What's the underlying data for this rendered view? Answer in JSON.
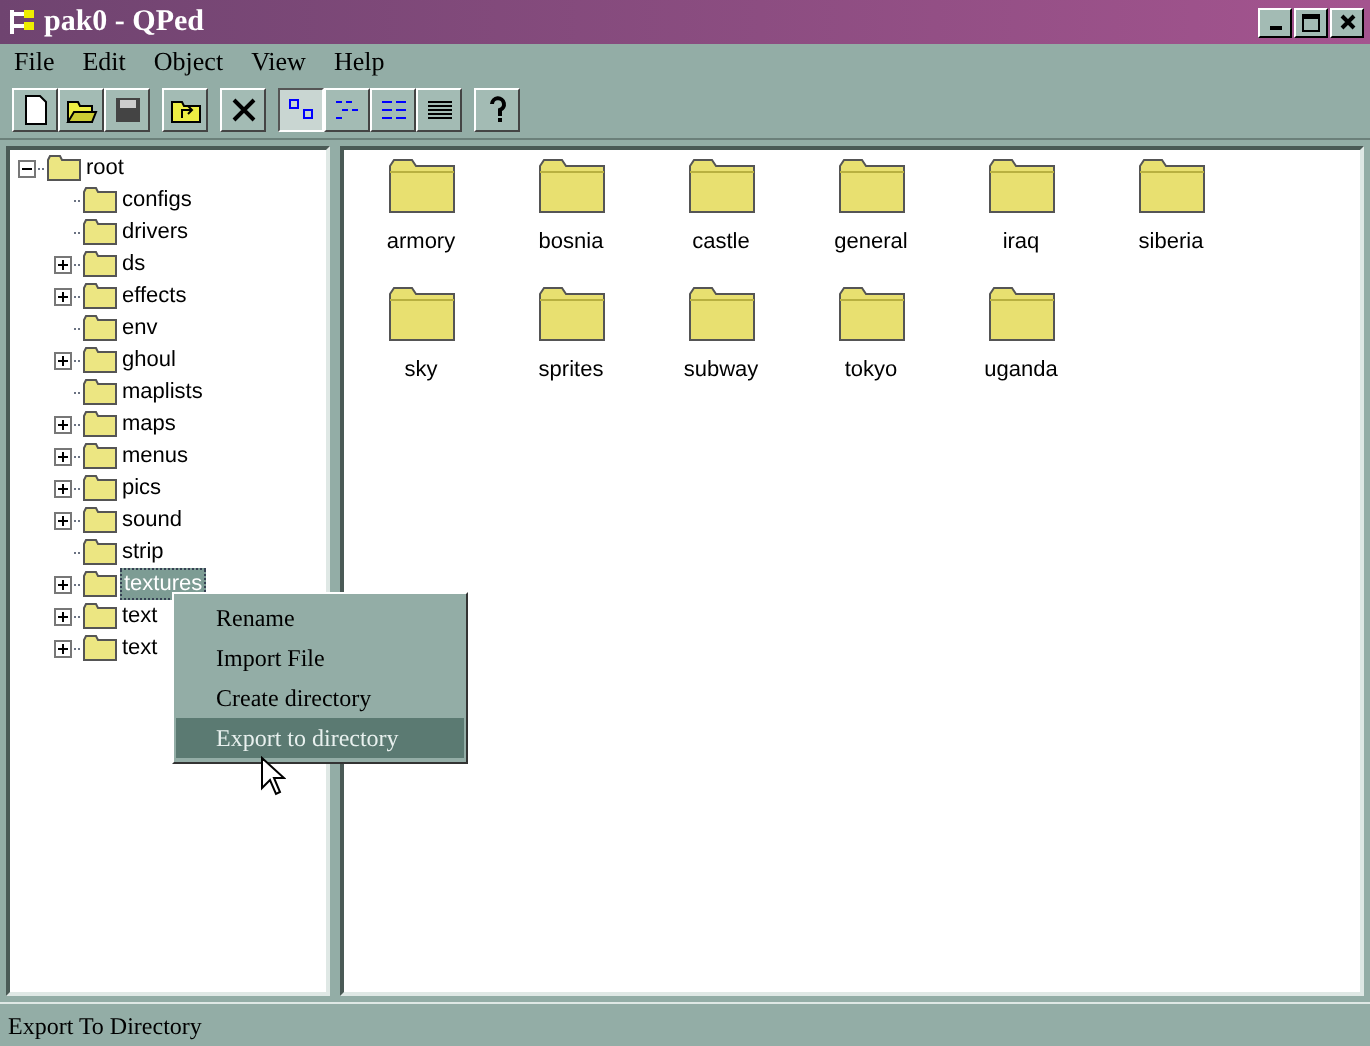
{
  "window": {
    "title": "pak0 - QPed"
  },
  "menu_bar": [
    "File",
    "Edit",
    "Object",
    "View",
    "Help"
  ],
  "toolbar": {
    "view_modes": [
      {
        "selected": true
      },
      {
        "selected": false
      },
      {
        "selected": false
      },
      {
        "selected": false
      }
    ]
  },
  "tree": {
    "label": "root",
    "kind": "expanded",
    "selected": false,
    "children": [
      {
        "label": "configs",
        "kind": "leaf",
        "selected": false
      },
      {
        "label": "drivers",
        "kind": "leaf",
        "selected": false
      },
      {
        "label": "ds",
        "kind": "collapsed",
        "selected": false
      },
      {
        "label": "effects",
        "kind": "collapsed",
        "selected": false
      },
      {
        "label": "env",
        "kind": "leaf",
        "selected": false
      },
      {
        "label": "ghoul",
        "kind": "collapsed",
        "selected": false
      },
      {
        "label": "maplists",
        "kind": "leaf",
        "selected": false
      },
      {
        "label": "maps",
        "kind": "collapsed",
        "selected": false
      },
      {
        "label": "menus",
        "kind": "collapsed",
        "selected": false
      },
      {
        "label": "pics",
        "kind": "collapsed",
        "selected": false
      },
      {
        "label": "sound",
        "kind": "collapsed",
        "selected": false
      },
      {
        "label": "strip",
        "kind": "leaf",
        "selected": false
      },
      {
        "label": "textures",
        "kind": "collapsed",
        "selected": true
      },
      {
        "label": "text",
        "kind": "collapsed",
        "selected": false
      },
      {
        "label": "text",
        "kind": "collapsed",
        "selected": false
      }
    ]
  },
  "folders": [
    "armory",
    "bosnia",
    "castle",
    "general",
    "iraq",
    "siberia",
    "sky",
    "sprites",
    "subway",
    "tokyo",
    "uganda"
  ],
  "context_menu": [
    {
      "label": "Rename",
      "selected": false
    },
    {
      "label": "Import File",
      "selected": false
    },
    {
      "label": "Create directory",
      "selected": false
    },
    {
      "label": "Export to directory",
      "selected": true
    }
  ],
  "status_bar": "Export To Directory"
}
